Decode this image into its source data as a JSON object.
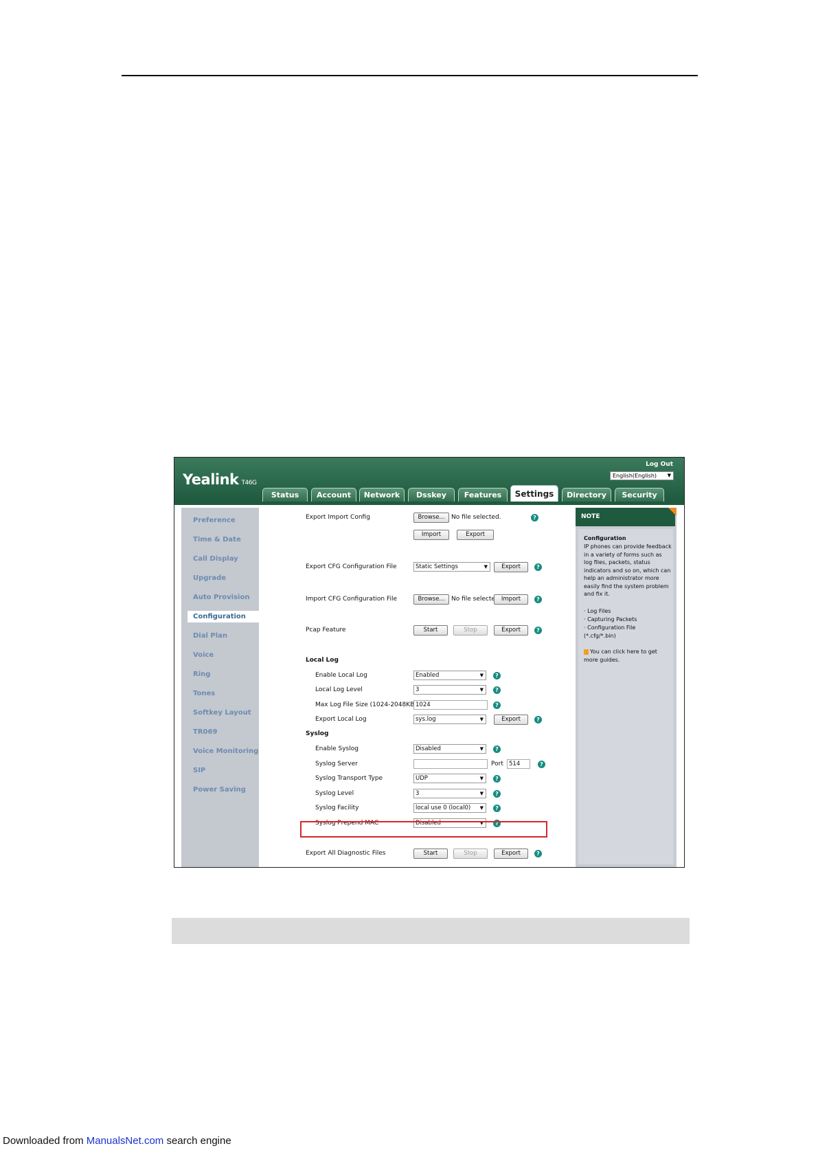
{
  "app": {
    "logo": "Yealink",
    "model": "T46G",
    "logout": "Log Out",
    "language": "English(English)"
  },
  "tabs": [
    "Status",
    "Account",
    "Network",
    "Dsskey",
    "Features",
    "Settings",
    "Directory",
    "Security"
  ],
  "active_tab": "Settings",
  "sidebar": [
    "Preference",
    "Time & Date",
    "Call Display",
    "Upgrade",
    "Auto Provision",
    "Configuration",
    "Dial Plan",
    "Voice",
    "Ring",
    "Tones",
    "Softkey Layout",
    "TR069",
    "Voice Monitoring",
    "SIP",
    "Power Saving"
  ],
  "active_sidebar": "Configuration",
  "form": {
    "export_import_config": {
      "label": "Export Import Config",
      "browse": "Browse...",
      "file_status": "No file selected.",
      "import": "Import",
      "export": "Export"
    },
    "export_cfg": {
      "label": "Export CFG Configuration File",
      "value": "Static Settings",
      "export": "Export"
    },
    "import_cfg": {
      "label": "Import CFG Configuration File",
      "browse": "Browse...",
      "file_status": "No file selected",
      "import": "Import"
    },
    "pcap": {
      "label": "Pcap Feature",
      "start": "Start",
      "stop": "Stop",
      "export": "Export"
    },
    "local_log": {
      "heading": "Local Log",
      "enable_label": "Enable Local Log",
      "enable_value": "Enabled",
      "level_label": "Local Log Level",
      "level_value": "3",
      "max_size_label": "Max Log File Size (1024-2048KB)",
      "max_size_value": "1024",
      "export_label": "Export Local Log",
      "export_value": "sys.log",
      "export": "Export"
    },
    "syslog": {
      "heading": "Syslog",
      "enable_label": "Enable Syslog",
      "enable_value": "Disabled",
      "server_label": "Syslog Server",
      "server_value": "",
      "port_label": "Port",
      "port_value": "514",
      "transport_label": "Syslog Transport Type",
      "transport_value": "UDP",
      "level_label": "Syslog Level",
      "level_value": "3",
      "facility_label": "Syslog Facility",
      "facility_value": "local use 0 (local0)",
      "prepend_label": "Syslog Prepend MAC",
      "prepend_value": "Disabled"
    },
    "diagnostic": {
      "label": "Export All Diagnostic Files",
      "start": "Start",
      "stop": "Stop",
      "export": "Export"
    }
  },
  "note": {
    "title": "NOTE",
    "heading": "Configuration",
    "body": "IP phones can provide feedback in a variety of forms such as log files, packets, status indicators and so on, which can help an administrator more easily find the system problem and fix it.",
    "bullets": [
      "· Log Files",
      "· Capturing Packets",
      "· Configuration File",
      "(*.cfg/*.bin)"
    ],
    "guide": "You can click here to get more guides."
  },
  "footer": {
    "prefix": "Downloaded from ",
    "link": "ManualsNet.com",
    "suffix": " search engine"
  },
  "colors": {
    "header_green": "#1f5a3e",
    "help_teal": "#168c80",
    "highlight_red": "#d9252b",
    "note_orange": "#f08a24"
  }
}
